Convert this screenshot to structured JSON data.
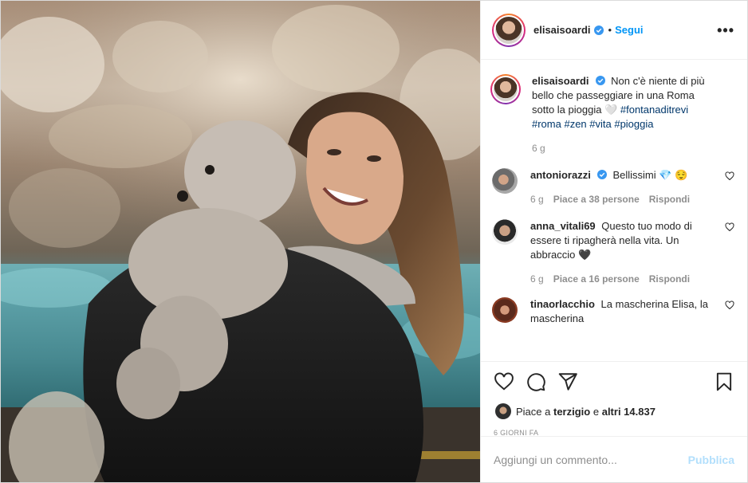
{
  "post": {
    "author": {
      "username": "elisaisoardi",
      "verified_icon": "verified-badge-icon"
    },
    "follow_label": "Segui",
    "dot_separator": "•",
    "more_label": "•••",
    "caption": {
      "text": "Non c'è niente di più bello che passeggiare in una Roma sotto la pioggia 🤍",
      "hashtags": "#fontanaditrevi #roma #zen #vita #pioggia",
      "time": "6 g"
    },
    "comments": [
      {
        "username": "antoniorazzi",
        "verified": true,
        "text": "Bellissimi 💎 😌",
        "time": "6 g",
        "likes": "Piace a 38 persone",
        "reply": "Rispondi"
      },
      {
        "username": "anna_vitali69",
        "verified": false,
        "text": "Questo tuo modo di essere ti ripagherà nella vita. Un abbraccio 🖤",
        "time": "6 g",
        "likes": "Piace a 16 persone",
        "reply": "Rispondi"
      },
      {
        "username": "tinaorlacchio",
        "verified": false,
        "text": "La mascherina Elisa, la mascherina"
      }
    ],
    "likes_line": {
      "prefix": "Piace a",
      "user": "terzigio",
      "joiner": "e",
      "rest": "altri 14.837"
    },
    "date": "6 GIORNI FA",
    "add_comment": {
      "placeholder": "Aggiungi un commento...",
      "publish_label": "Pubblica"
    }
  },
  "colors": {
    "accent": "#0095f6",
    "hashtag": "#00376b",
    "muted": "#8e8e8e",
    "publish_disabled": "#b2dffc"
  }
}
